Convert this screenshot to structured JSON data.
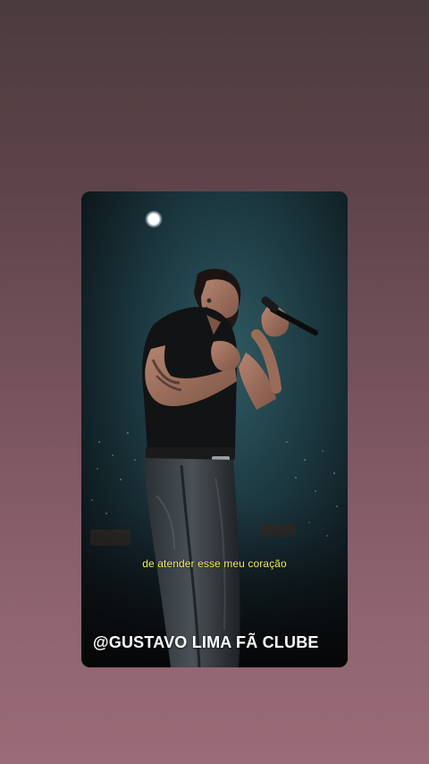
{
  "video": {
    "subtitle": "de atender esse meu coração",
    "watermark": "@GUSTAVO LIMA FÃ CLUBE"
  },
  "colors": {
    "background_top": "#4b3b3e",
    "background_bottom": "#9a6b78",
    "subtitle": "#f3ea5c",
    "watermark": "#ffffff"
  }
}
